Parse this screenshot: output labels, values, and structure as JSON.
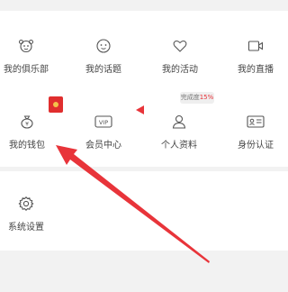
{
  "grid_row1": [
    {
      "label": "我的俱乐部",
      "icon": "club-icon"
    },
    {
      "label": "我的话题",
      "icon": "topic-icon"
    },
    {
      "label": "我的活动",
      "icon": "heart-icon"
    },
    {
      "label": "我的直播",
      "icon": "live-camera-icon"
    }
  ],
  "grid_row2": [
    {
      "label": "我的钱包",
      "icon": "wallet-icon"
    },
    {
      "label": "会员中心",
      "icon": "vip-icon"
    },
    {
      "label": "个人资料",
      "icon": "profile-icon"
    },
    {
      "label": "身份认证",
      "icon": "id-card-icon"
    }
  ],
  "profile_badge": {
    "prefix": "完成度",
    "value": "15%"
  },
  "settings": {
    "label": "系统设置",
    "icon": "gear-icon"
  },
  "colors": {
    "accent_red": "#e8343a",
    "background": "#f2f2f2"
  }
}
